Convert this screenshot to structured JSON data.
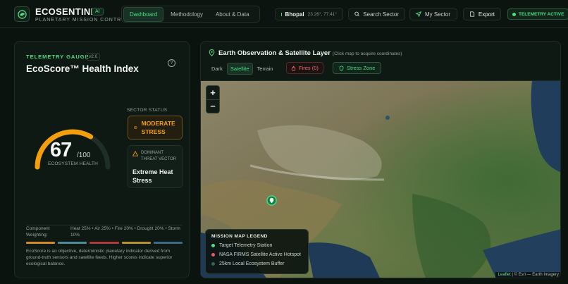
{
  "app": {
    "name": "ECOSENTINEL",
    "badge": "AI",
    "tagline": "PLANETARY MISSION CONTROL"
  },
  "nav": {
    "tabs": [
      {
        "label": "Dashboard",
        "active": true
      },
      {
        "label": "Methodology",
        "active": false
      },
      {
        "label": "About & Data",
        "active": false
      }
    ]
  },
  "header": {
    "location_name": "Bhopal",
    "location_coords": "23.26°, 77.41°",
    "search_label": "Search Sector",
    "my_sector_label": "My Sector",
    "export_label": "Export",
    "telemetry_label": "TELEMETRY ACTIVE"
  },
  "gauge_panel": {
    "eyebrow": "TELEMETRY GAUGE",
    "version": "v2.0",
    "title": "EcoScore™ Health Index",
    "help_icon": "?",
    "score": "67",
    "score_max": "/100",
    "score_fraction": 0.67,
    "score_caption": "ECOSYSTEM HEALTH",
    "sector_status_label": "SECTOR STATUS",
    "sector_status": "MODERATE STRESS",
    "threat_label": "DOMINANT THREAT VECTOR",
    "threat_value": "Extreme Heat Stress",
    "weighting_label": "Component Weighting:",
    "weighting_value": "Heat 25% • Air 25% • Fire 20% • Drought 20% • Storm 10%",
    "weight_colors": [
      "#d08a1e",
      "#4a8a9a",
      "#b23a3a",
      "#b8902a",
      "#3a6a8a"
    ],
    "description": "EcoScore is an objective, deterministic planetary indicator derived from ground-truth sensors and satellite feeds. Higher scores indicate superior ecological balance."
  },
  "map_panel": {
    "title": "Earth Observation & Satellite Layer",
    "hint": "(Click map to acquire coordinates)",
    "layers": [
      {
        "label": "Dark",
        "active": false
      },
      {
        "label": "Satellite",
        "active": true
      },
      {
        "label": "Terrain",
        "active": false
      }
    ],
    "fires_label": "Fires (0)",
    "stress_label": "Stress Zone",
    "zoom_in": "+",
    "zoom_out": "−",
    "legend": {
      "title": "MISSION MAP LEGEND",
      "items": [
        {
          "label": "Target Telemetry Station",
          "color": "#4ade80"
        },
        {
          "label": "NASA FIRMS Satellite Active Hotspot",
          "color": "#ef5b5b"
        },
        {
          "label": "25km Local Ecosystem Buffer",
          "color": "#2f6a45"
        }
      ]
    },
    "attribution_link": "Leaflet",
    "attribution_rest": "| © Esri — Earth Imagery"
  },
  "colors": {
    "accent": "#4ade80",
    "warning": "#f59e0b",
    "danger": "#ef6b6b",
    "background": "#0b130f"
  }
}
